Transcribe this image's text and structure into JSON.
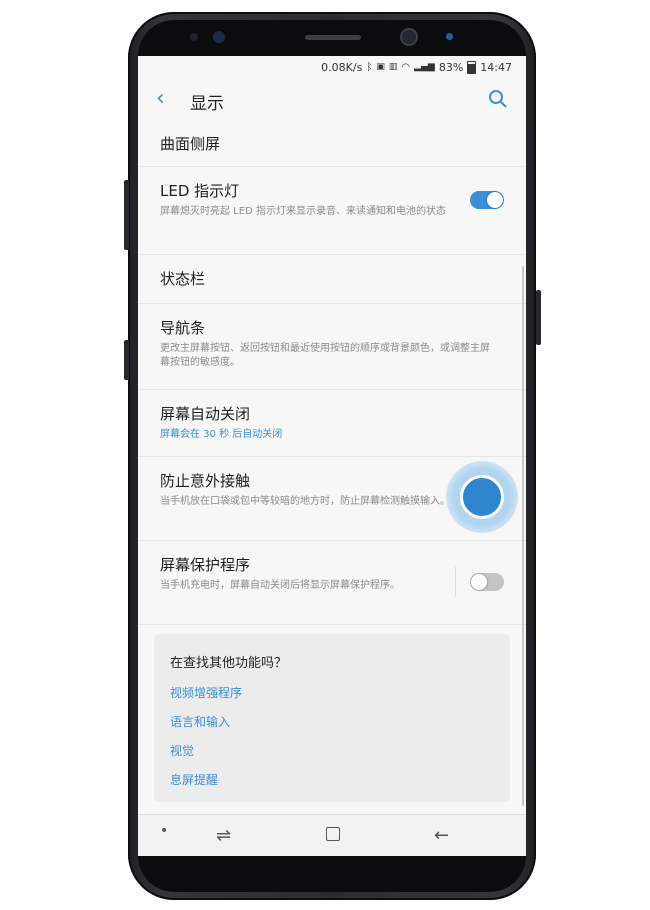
{
  "status_bar": {
    "speed": "0.08K/s",
    "battery": "83%",
    "time": "14:47"
  },
  "app_bar": {
    "title": "显示",
    "icons": [
      "back-chevron-icon",
      "search-icon"
    ]
  },
  "settings": [
    {
      "title": "曲面侧屏"
    },
    {
      "title": "LED 指示灯",
      "subtitle": "屏幕熄灭时亮起 LED 指示灯来显示录音、来读通知和电池的状态",
      "toggle": true
    },
    {
      "title": "状态栏"
    },
    {
      "title": "导航条",
      "subtitle": "更改主屏幕按钮、返回按钮和最近使用按钮的顺序或背景颜色，或调整主屏幕按钮的敏感度。"
    },
    {
      "title": "屏幕自动关闭",
      "subtitle": "屏幕会在 30 秒 后自动关闭"
    },
    {
      "title": "防止意外接触",
      "subtitle": "当手机放在口袋或包中等较暗的地方时，防止屏幕检测触摸输入。",
      "toggle": true
    },
    {
      "title": "屏幕保护程序",
      "subtitle": "当手机充电时，屏幕自动关闭后将显示屏幕保护程序。",
      "toggle": false
    }
  ],
  "suggestions": {
    "title": "在查找其他功能吗？",
    "links": [
      "视频增强程序",
      "语言和输入",
      "视觉",
      "息屏提醒"
    ]
  },
  "colors": {
    "accent": "#3a8fd6",
    "toggle_on": "#3a8fd6",
    "toggle_off": "#c4c4c4"
  }
}
